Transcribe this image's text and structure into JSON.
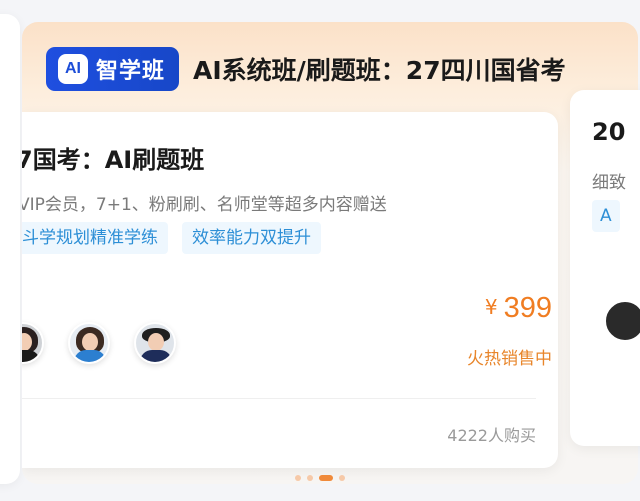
{
  "header": {
    "brand_badge": "AI",
    "brand_name": "智学班",
    "title": "AI系统班/刷题班：27四川国省考"
  },
  "card": {
    "title": "7国考：AI刷题班",
    "subtitle": "VIP会员，7+1、粉刷刷、名师堂等超多内容赠送",
    "tags": [
      "斗学规划精准学练",
      "效率能力双提升"
    ],
    "avatars": [
      "teacher-1",
      "teacher-2",
      "teacher-3"
    ],
    "price_symbol": "¥",
    "price": "399",
    "status": "火热销售中",
    "buyers": "4222人购买"
  },
  "next_card": {
    "title": "20",
    "subtitle": "细致",
    "tag": "A"
  },
  "carousel": {
    "dot_count": 4,
    "active_index": 2
  },
  "colors": {
    "brand_blue": "#1f4fe0",
    "price_orange": "#f07d22",
    "tag_blue": "#2d8fd6",
    "dot_active": "#f08a3a"
  }
}
